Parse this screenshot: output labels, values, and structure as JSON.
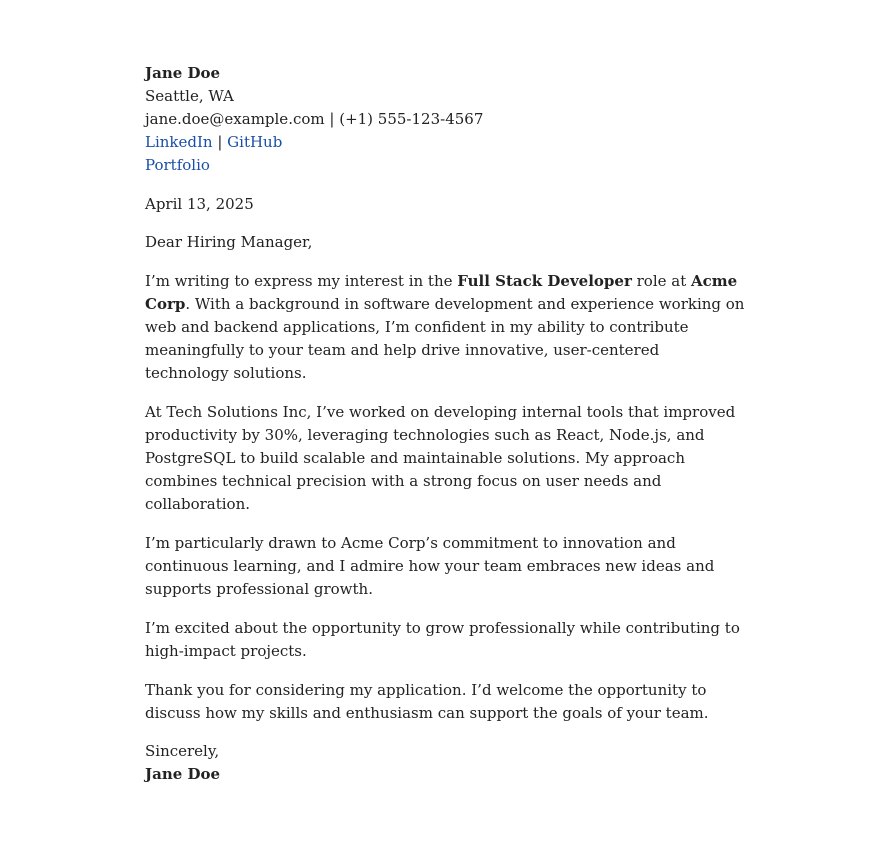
{
  "sender": {
    "name": "Jane Doe",
    "location": "Seattle, WA",
    "email": "jane.doe@example.com",
    "contact_separator": " | ",
    "phone": "(+1) 555-123-4567",
    "links": {
      "linkedin": "LinkedIn",
      "link_separator": " | ",
      "github": "GitHub",
      "portfolio": "Portfolio"
    }
  },
  "date": "April 13, 2025",
  "salutation": "Dear Hiring Manager,",
  "body": {
    "p1": {
      "pre": "I’m writing to express my interest in the ",
      "role": "Full Stack Developer",
      "mid": " role at ",
      "company": "Acme Corp",
      "post": ". With a background in software development and experience working on web and backend applications, I’m confident in my ability to contribute meaningfully to your team and help drive innovative, user-centered technology solutions."
    },
    "p2": "At Tech Solutions Inc, I’ve worked on developing internal tools that improved productivity by 30%, leveraging technologies such as React, Node.js, and PostgreSQL to build scalable and maintainable solutions. My approach combines technical precision with a strong focus on user needs and collaboration.",
    "p3": "I’m particularly drawn to Acme Corp’s commitment to innovation and continuous learning, and I admire how your team embraces new ideas and supports professional growth.",
    "p4": "I’m excited about the opportunity to grow professionally while contributing to high-impact projects.",
    "p5": "Thank you for considering my application. I’d welcome the opportunity to discuss how my skills and enthusiasm can support the goals of your team."
  },
  "closing": {
    "valediction": "Sincerely,",
    "signature": "Jane Doe"
  },
  "colors": {
    "text": "#222222",
    "link": "#1a4ea8",
    "background": "#ffffff"
  }
}
